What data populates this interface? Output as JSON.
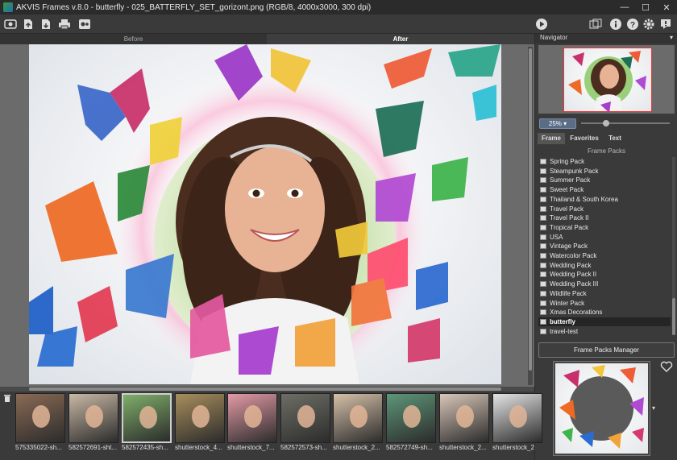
{
  "window": {
    "title": "AKVIS Frames v.8.0 - butterfly - 025_BATTERFLY_SET_gorizont.png (RGB/8, 4000x3000, 300 dpi)",
    "minimize": "—",
    "maximize": "☐",
    "close": "✕"
  },
  "toolbar": {
    "left_icons": [
      "open-icon",
      "upload-icon",
      "save-icon",
      "print-icon",
      "batch-icon"
    ],
    "right_icons": [
      "play-icon",
      "display-mode-icon",
      "info-icon",
      "help-icon",
      "settings-icon",
      "alert-icon"
    ]
  },
  "view_tabs": {
    "before": "Before",
    "after": "After"
  },
  "navigator": {
    "title": "Navigator",
    "collapse": "▾",
    "zoom": "25% ▾"
  },
  "panel_tabs": [
    "Frame",
    "Favorites",
    "Text"
  ],
  "frame_packs": {
    "title": "Frame Packs",
    "items": [
      "Spring Pack",
      "Steampunk Pack",
      "Summer Pack",
      "Sweet Pack",
      "Thailand & South Korea",
      "Travel Pack",
      "Travel Pack II",
      "Tropical Pack",
      "USA",
      "Vintage Pack",
      "Watercolor Pack",
      "Wedding Pack",
      "Wedding Pack II",
      "Wedding Pack III",
      "Wildlife Pack",
      "Winter Pack",
      "Xmas Decorations",
      "butterfly",
      "travel-test"
    ],
    "selected": "butterfly",
    "manager_button": "Frame Packs Manager",
    "dropdown_arrow": "▾"
  },
  "thumbnails": [
    {
      "caption": "575335022-sh...",
      "color": "#8a6a55"
    },
    {
      "caption": "582572691-sht...",
      "color": "#c9b8a4"
    },
    {
      "caption": "582572435-sh...",
      "color": "#7fae6a"
    },
    {
      "caption": "shutterstock_4...",
      "color": "#a88e5c"
    },
    {
      "caption": "shutterstock_7...",
      "color": "#e39aa6"
    },
    {
      "caption": "582572573-sh...",
      "color": "#6e6e66"
    },
    {
      "caption": "shutterstock_2...",
      "color": "#d6c0a8"
    },
    {
      "caption": "582572749-sh...",
      "color": "#5d9678"
    },
    {
      "caption": "shutterstock_2...",
      "color": "#d8c6b8"
    },
    {
      "caption": "shutterstock_2",
      "color": "#e4e4e4"
    }
  ],
  "colors": {
    "accent": "#5b6d86",
    "background": "#3a3a3a",
    "canvas": "#6b6b6b"
  }
}
